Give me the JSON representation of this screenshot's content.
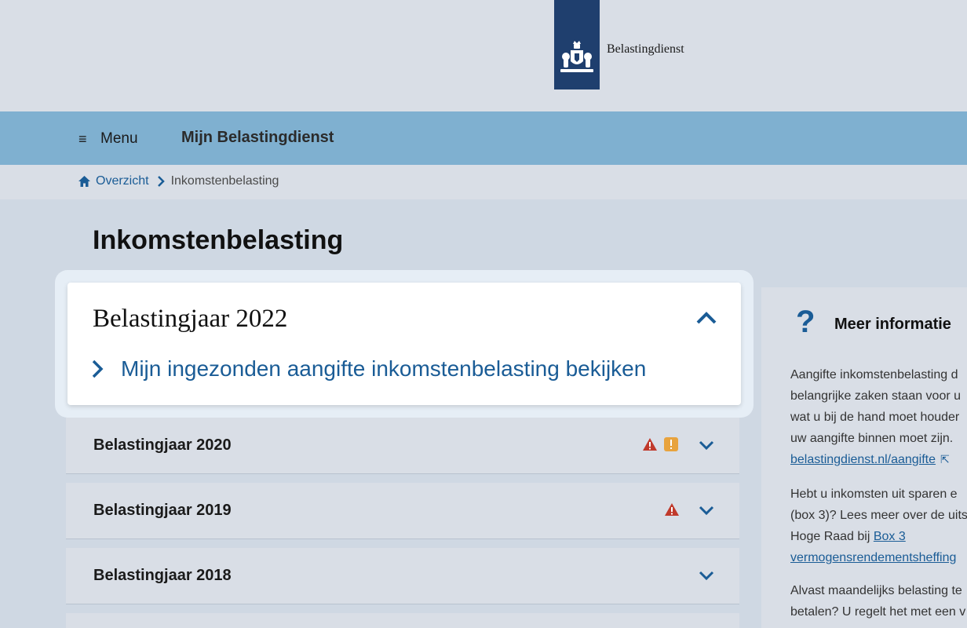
{
  "header": {
    "brand": "Belastingdienst",
    "logo_icon": "royal-coat-of-arms-icon"
  },
  "nav": {
    "menu_label": "Menu",
    "title": "Mijn Belastingdienst"
  },
  "breadcrumb": {
    "home": "Overzicht",
    "current": "Inkomstenbelasting"
  },
  "page": {
    "title": "Inkomstenbelasting"
  },
  "expanded": {
    "title": "Belastingjaar 2022",
    "link": "Mijn ingezonden aangifte inkomstenbelasting bekijken"
  },
  "years": [
    {
      "label": "Belastingjaar 2020",
      "alerts": [
        "error",
        "warning"
      ]
    },
    {
      "label": "Belastingjaar 2019",
      "alerts": [
        "error"
      ]
    },
    {
      "label": "Belastingjaar 2018",
      "alerts": []
    }
  ],
  "sidebar": {
    "heading": "Meer informatie",
    "p1": [
      "Aangifte inkomstenbelasting d",
      "belangrijke zaken staan voor u",
      "wat u bij de hand moet houder",
      "uw aangifte binnen moet zijn."
    ],
    "p1_link": "belastingdienst.nl/aangifte",
    "p2": [
      "Hebt u inkomsten uit sparen e",
      "(box 3)? Lees meer over de uits",
      "Hoge Raad bij "
    ],
    "p2_link_a": "Box 3",
    "p2_link_b": "vermogensrendementsheffing",
    "p3": [
      "Alvast maandelijks belasting te",
      "betalen? U regelt het met een v"
    ]
  },
  "colors": {
    "brand_blue": "#1f3f6e",
    "link_blue": "#1a5c96",
    "nav_blue": "#7fb0d0",
    "error_red": "#c0392b",
    "warning_orange": "#e8a33d"
  }
}
